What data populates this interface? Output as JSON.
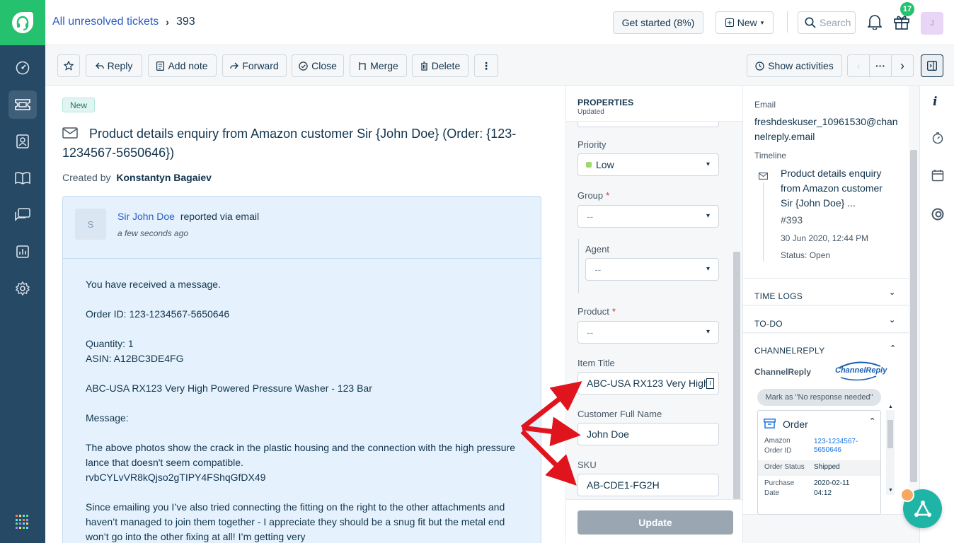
{
  "topbar": {
    "breadcrumb_link": "All unresolved tickets",
    "ticket_number": "393",
    "get_started": "Get started (8%)",
    "new_label": "New",
    "search_placeholder": "Search",
    "gift_badge": "17",
    "avatar_initial": "J"
  },
  "toolbar": {
    "reply": "Reply",
    "add_note": "Add note",
    "forward": "Forward",
    "close": "Close",
    "merge": "Merge",
    "delete": "Delete",
    "more": "⋮",
    "show_activities": "Show activities",
    "pager_more": "···"
  },
  "ticket": {
    "status_badge": "New",
    "subject": "Product details enquiry from Amazon customer Sir {John Doe} (Order: {123-1234567-5650646})",
    "created_by_label": "Created by",
    "created_by": "Konstantyn Bagaiev",
    "requester_initial": "S",
    "requester": "Sir John Doe",
    "reported_via": "reported via email",
    "time_ago": "a few seconds ago",
    "body_lines": [
      "You have received a message.",
      "Order ID: 123-1234567-5650646",
      "Quantity: 1",
      "ASIN: A12BC3DE4FG",
      "ABC-USA RX123 Very High Powered Pressure Washer - 123 Bar",
      "Message:",
      "The above photos show the crack in the plastic housing and the connection with the high pressure",
      "lance that doesn't seem compatible.",
      "rvbCYLvVR8kQjso2gTIPY4FShqGfDX49",
      "Since emailing you I’ve also tried connecting the fitting on the right to the other attachments and",
      "haven’t managed to join them together - I appreciate they should be a snug fit but the metal end",
      "won’t go into the other fixing at all! I’m getting very"
    ]
  },
  "properties": {
    "title": "PROPERTIES",
    "subtitle": "Updated",
    "priority_label": "Priority",
    "priority_value": "Low",
    "group_label": "Group",
    "group_value": "--",
    "agent_label": "Agent",
    "agent_value": "--",
    "product_label": "Product",
    "product_value": "--",
    "item_title_label": "Item Title",
    "item_title_value": "ABC-USA RX123 Very High",
    "customer_name_label": "Customer Full Name",
    "customer_name_value": "John Doe",
    "sku_label": "SKU",
    "sku_value": "AB-CDE1-FG2H",
    "update_button": "Update",
    "required_mark": "*"
  },
  "contact": {
    "email_label": "Email",
    "email_line1": "freshdeskuser_10961530@chan",
    "email_line2": "nelreply.email",
    "timeline_label": "Timeline",
    "timeline_title_lines": [
      "Product details enquiry",
      "from Amazon customer",
      "Sir {John Doe} ..."
    ],
    "timeline_ticket": "#393",
    "timeline_date": "30 Jun 2020, 12:44 PM",
    "timeline_status": "Status: Open"
  },
  "sections": {
    "time_logs": "TIME LOGS",
    "todo": "TO-DO",
    "channelreply": "CHANNELREPLY"
  },
  "channelreply": {
    "app_name": "ChannelReply",
    "logo_text": "ChannelReply",
    "mark_button": "Mark as \"No response needed\"",
    "order_title": "Order",
    "amazon_order_id_label_1": "Amazon",
    "amazon_order_id_label_2": "Order ID",
    "amazon_order_id_value_1": "123-1234567-",
    "amazon_order_id_value_2": "5650646",
    "order_status_label": "Order Status",
    "order_status_value": "Shipped",
    "purchase_label_1": "Purchase",
    "purchase_label_2": "Date",
    "purchase_value_1": "2020-02-11",
    "purchase_value_2": "04:12"
  },
  "colors": {
    "nav_bg": "#264966",
    "logo_green": "#25c16f",
    "link_blue": "#2c5cc5",
    "arrow_red": "#e0141c",
    "priority_green": "#a0d76a"
  }
}
